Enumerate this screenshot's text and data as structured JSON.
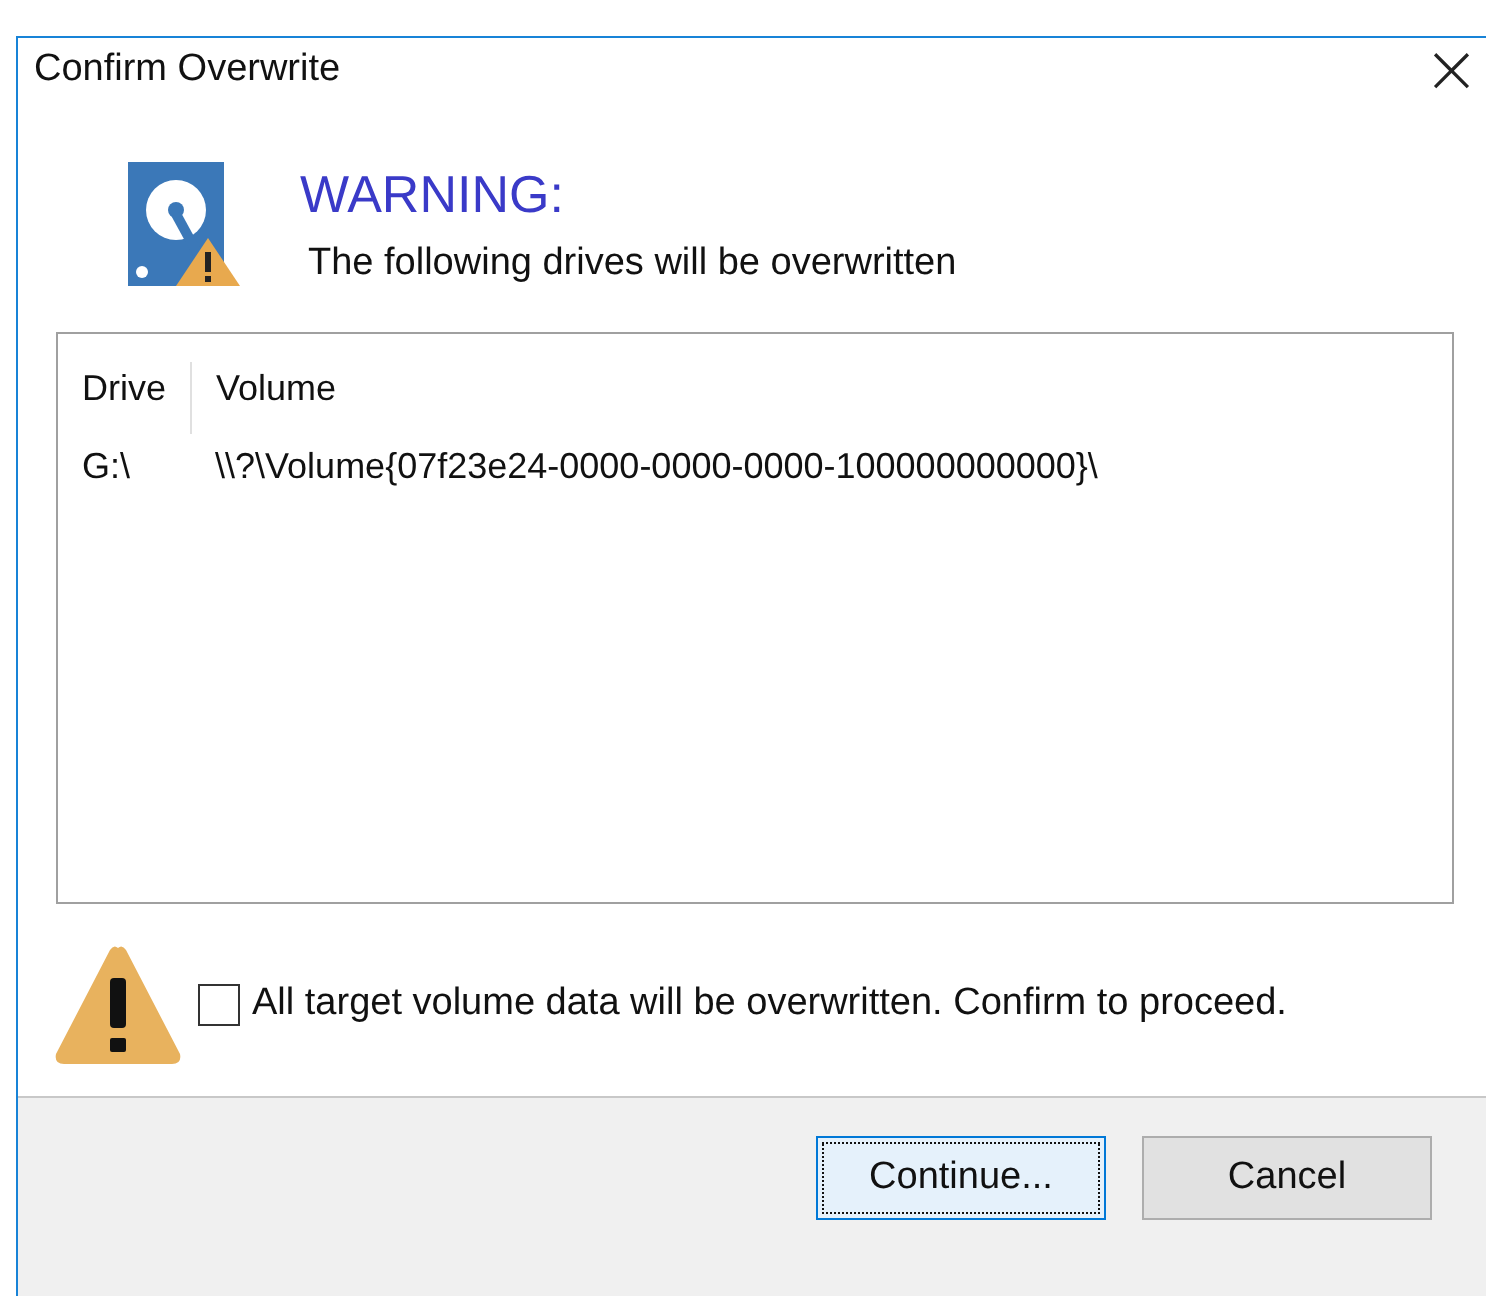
{
  "window": {
    "title": "Confirm Overwrite",
    "close": "×"
  },
  "header": {
    "heading": "WARNING:",
    "message": "The following drives will be overwritten"
  },
  "table": {
    "columns": [
      "Drive",
      "Volume"
    ],
    "rows": [
      [
        "G:\\",
        "\\\\?\\Volume{07f23e24-0000-0000-0000-100000000000}\\"
      ]
    ]
  },
  "confirm": {
    "label": "All target volume data will be overwritten. Confirm to proceed.",
    "checked": false
  },
  "buttons": [
    {
      "label": "Continue...",
      "focused": true
    },
    {
      "label": "Cancel",
      "focused": false
    }
  ]
}
